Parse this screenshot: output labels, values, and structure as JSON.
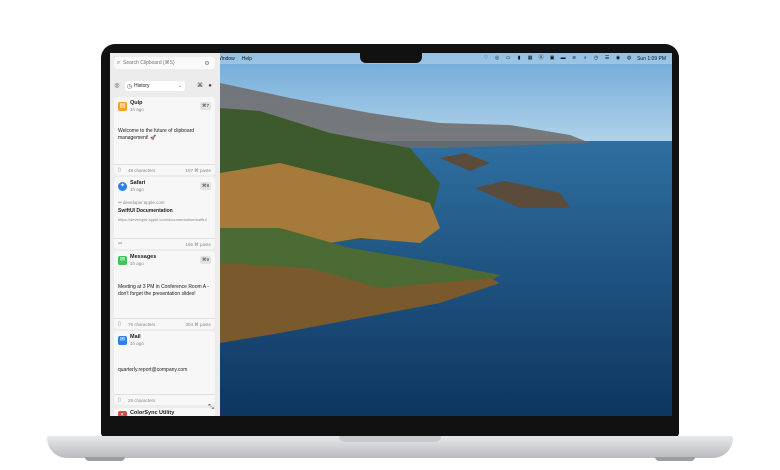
{
  "menubar": {
    "app_menus": [
      "Window",
      "Help"
    ],
    "clock": "Sun 1:09 PM"
  },
  "panel": {
    "search_placeholder": "Search Clipboard (⌘S)",
    "filter": {
      "label": "History"
    },
    "cards": [
      {
        "app": "Quip",
        "time": "1h ago",
        "shortcut": "⌘7",
        "icon_color": "#f4a324",
        "content": "Welcome to the future of clipboard management! 🚀",
        "footer_left": "48 characters",
        "footer_right": "187 ⌘ paste"
      },
      {
        "app": "Safari",
        "time": "1h ago",
        "shortcut": "⌘8",
        "icon_color": "#2f80ed",
        "domain": "developer.apple.com",
        "link_title": "SwiftUI Documentation",
        "url": "https://developer.apple.com/documentation/swiftui",
        "footer_left": "",
        "footer_right": "165 ⌘ paste"
      },
      {
        "app": "Messages",
        "time": "1h ago",
        "shortcut": "⌘9",
        "icon_color": "#3cc55a",
        "content": "Meeting at 3 PM in Conference Room A - don't forget the presentation slides!",
        "footer_left": "76 characters",
        "footer_right": "304 ⌘ paste"
      },
      {
        "app": "Mail",
        "time": "1h ago",
        "icon_color": "#2f80ed",
        "content": "quarterly.report@company.com",
        "footer_left": "28 characters"
      }
    ],
    "partial_card": {
      "app": "ColorSync Utility"
    }
  }
}
